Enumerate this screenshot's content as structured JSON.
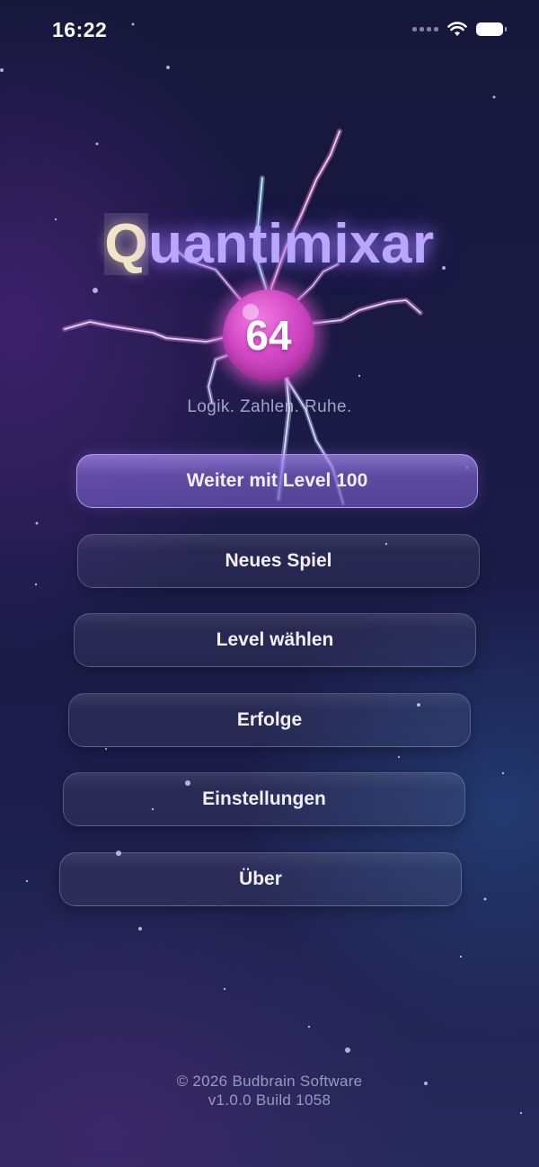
{
  "status_bar": {
    "time": "16:22"
  },
  "app": {
    "title_first_letter": "Q",
    "title_rest": "uantimixar",
    "orb_value": "64",
    "tagline": "Logik. Zahlen. Ruhe."
  },
  "menu": {
    "continue_label": "Weiter mit Level 100",
    "new_game_label": "Neues Spiel",
    "select_level_label": "Level wählen",
    "achievements_label": "Erfolge",
    "settings_label": "Einstellungen",
    "about_label": "Über"
  },
  "footer": {
    "copyright": "© 2026 Budbrain Software",
    "version": "v1.0.0 Build 1058"
  },
  "colors": {
    "title": "#b9a6ff",
    "orb": "#d248c6",
    "primary_button": "#7a5fc8"
  }
}
